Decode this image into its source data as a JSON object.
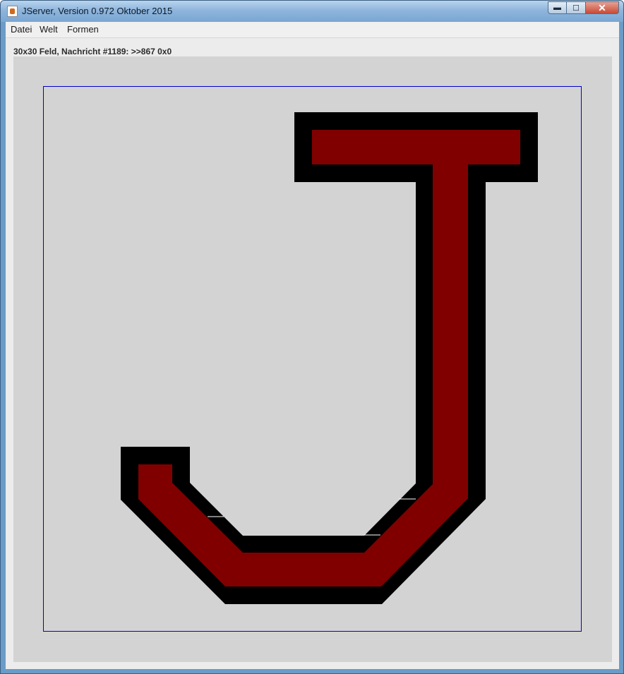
{
  "window": {
    "title": "JServer, Version 0.972 Oktober 2015",
    "icon": "java-icon",
    "controls": {
      "minimize": "▬",
      "maximize": "☐",
      "close": "✕"
    }
  },
  "menu": {
    "items": [
      {
        "label": "Datei"
      },
      {
        "label": "Welt"
      },
      {
        "label": "Formen"
      }
    ]
  },
  "status": {
    "text": "30x30 Feld, Nachricht #1189: >>867 0x0"
  },
  "colors": {
    "shape_fill": "#800000",
    "shape_outline": "#000000",
    "field_border": "#0000cc",
    "field_background": "#d3d3d3"
  },
  "shape": {
    "letter": "J"
  }
}
